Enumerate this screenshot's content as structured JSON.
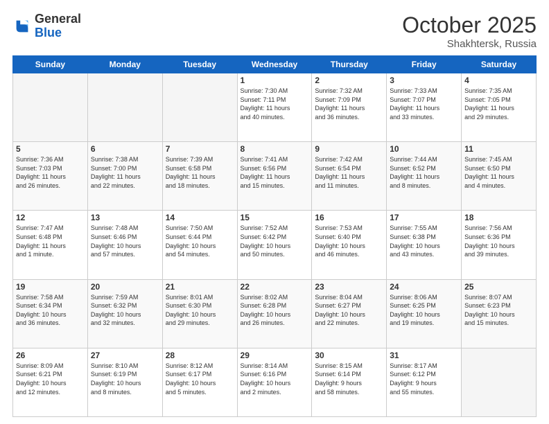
{
  "header": {
    "logo_general": "General",
    "logo_blue": "Blue",
    "month": "October 2025",
    "location": "Shakhtersk, Russia"
  },
  "weekdays": [
    "Sunday",
    "Monday",
    "Tuesday",
    "Wednesday",
    "Thursday",
    "Friday",
    "Saturday"
  ],
  "weeks": [
    [
      {
        "day": "",
        "info": ""
      },
      {
        "day": "",
        "info": ""
      },
      {
        "day": "",
        "info": ""
      },
      {
        "day": "1",
        "info": "Sunrise: 7:30 AM\nSunset: 7:11 PM\nDaylight: 11 hours\nand 40 minutes."
      },
      {
        "day": "2",
        "info": "Sunrise: 7:32 AM\nSunset: 7:09 PM\nDaylight: 11 hours\nand 36 minutes."
      },
      {
        "day": "3",
        "info": "Sunrise: 7:33 AM\nSunset: 7:07 PM\nDaylight: 11 hours\nand 33 minutes."
      },
      {
        "day": "4",
        "info": "Sunrise: 7:35 AM\nSunset: 7:05 PM\nDaylight: 11 hours\nand 29 minutes."
      }
    ],
    [
      {
        "day": "5",
        "info": "Sunrise: 7:36 AM\nSunset: 7:03 PM\nDaylight: 11 hours\nand 26 minutes."
      },
      {
        "day": "6",
        "info": "Sunrise: 7:38 AM\nSunset: 7:00 PM\nDaylight: 11 hours\nand 22 minutes."
      },
      {
        "day": "7",
        "info": "Sunrise: 7:39 AM\nSunset: 6:58 PM\nDaylight: 11 hours\nand 18 minutes."
      },
      {
        "day": "8",
        "info": "Sunrise: 7:41 AM\nSunset: 6:56 PM\nDaylight: 11 hours\nand 15 minutes."
      },
      {
        "day": "9",
        "info": "Sunrise: 7:42 AM\nSunset: 6:54 PM\nDaylight: 11 hours\nand 11 minutes."
      },
      {
        "day": "10",
        "info": "Sunrise: 7:44 AM\nSunset: 6:52 PM\nDaylight: 11 hours\nand 8 minutes."
      },
      {
        "day": "11",
        "info": "Sunrise: 7:45 AM\nSunset: 6:50 PM\nDaylight: 11 hours\nand 4 minutes."
      }
    ],
    [
      {
        "day": "12",
        "info": "Sunrise: 7:47 AM\nSunset: 6:48 PM\nDaylight: 11 hours\nand 1 minute."
      },
      {
        "day": "13",
        "info": "Sunrise: 7:48 AM\nSunset: 6:46 PM\nDaylight: 10 hours\nand 57 minutes."
      },
      {
        "day": "14",
        "info": "Sunrise: 7:50 AM\nSunset: 6:44 PM\nDaylight: 10 hours\nand 54 minutes."
      },
      {
        "day": "15",
        "info": "Sunrise: 7:52 AM\nSunset: 6:42 PM\nDaylight: 10 hours\nand 50 minutes."
      },
      {
        "day": "16",
        "info": "Sunrise: 7:53 AM\nSunset: 6:40 PM\nDaylight: 10 hours\nand 46 minutes."
      },
      {
        "day": "17",
        "info": "Sunrise: 7:55 AM\nSunset: 6:38 PM\nDaylight: 10 hours\nand 43 minutes."
      },
      {
        "day": "18",
        "info": "Sunrise: 7:56 AM\nSunset: 6:36 PM\nDaylight: 10 hours\nand 39 minutes."
      }
    ],
    [
      {
        "day": "19",
        "info": "Sunrise: 7:58 AM\nSunset: 6:34 PM\nDaylight: 10 hours\nand 36 minutes."
      },
      {
        "day": "20",
        "info": "Sunrise: 7:59 AM\nSunset: 6:32 PM\nDaylight: 10 hours\nand 32 minutes."
      },
      {
        "day": "21",
        "info": "Sunrise: 8:01 AM\nSunset: 6:30 PM\nDaylight: 10 hours\nand 29 minutes."
      },
      {
        "day": "22",
        "info": "Sunrise: 8:02 AM\nSunset: 6:28 PM\nDaylight: 10 hours\nand 26 minutes."
      },
      {
        "day": "23",
        "info": "Sunrise: 8:04 AM\nSunset: 6:27 PM\nDaylight: 10 hours\nand 22 minutes."
      },
      {
        "day": "24",
        "info": "Sunrise: 8:06 AM\nSunset: 6:25 PM\nDaylight: 10 hours\nand 19 minutes."
      },
      {
        "day": "25",
        "info": "Sunrise: 8:07 AM\nSunset: 6:23 PM\nDaylight: 10 hours\nand 15 minutes."
      }
    ],
    [
      {
        "day": "26",
        "info": "Sunrise: 8:09 AM\nSunset: 6:21 PM\nDaylight: 10 hours\nand 12 minutes."
      },
      {
        "day": "27",
        "info": "Sunrise: 8:10 AM\nSunset: 6:19 PM\nDaylight: 10 hours\nand 8 minutes."
      },
      {
        "day": "28",
        "info": "Sunrise: 8:12 AM\nSunset: 6:17 PM\nDaylight: 10 hours\nand 5 minutes."
      },
      {
        "day": "29",
        "info": "Sunrise: 8:14 AM\nSunset: 6:16 PM\nDaylight: 10 hours\nand 2 minutes."
      },
      {
        "day": "30",
        "info": "Sunrise: 8:15 AM\nSunset: 6:14 PM\nDaylight: 9 hours\nand 58 minutes."
      },
      {
        "day": "31",
        "info": "Sunrise: 8:17 AM\nSunset: 6:12 PM\nDaylight: 9 hours\nand 55 minutes."
      },
      {
        "day": "",
        "info": ""
      }
    ]
  ]
}
